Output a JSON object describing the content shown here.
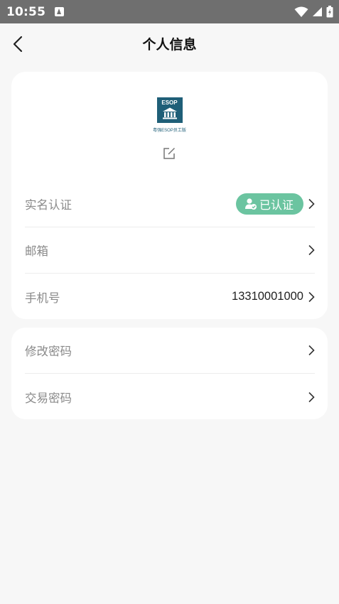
{
  "status_bar": {
    "time": "10:55"
  },
  "nav": {
    "title": "个人信息"
  },
  "profile": {
    "logo_text": "ESOP",
    "logo_caption": "粤强ESOP员工版",
    "rows": [
      {
        "label": "实名认证",
        "badge": "已认证"
      },
      {
        "label": "邮箱",
        "value": ""
      },
      {
        "label": "手机号",
        "value": "13310001000"
      }
    ]
  },
  "security": {
    "rows": [
      {
        "label": "修改密码"
      },
      {
        "label": "交易密码"
      }
    ]
  },
  "colors": {
    "badge_green": "#6bc4a0",
    "logo_blue": "#1f5f78",
    "status_bar": "#6f6f6f"
  }
}
